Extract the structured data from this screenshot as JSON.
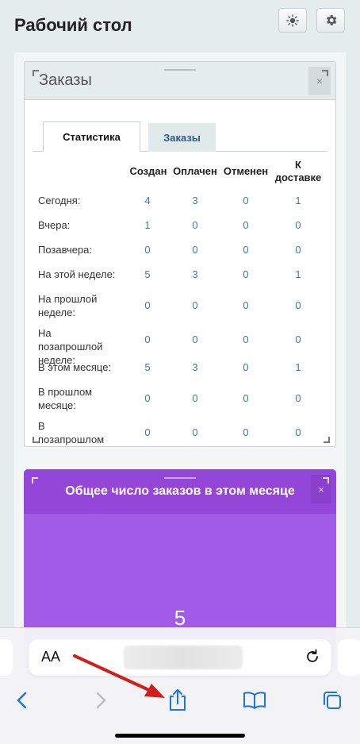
{
  "header": {
    "title": "Рабочий стол",
    "theme_icon": "sun-icon",
    "settings_icon": "gear-icon"
  },
  "orders_widget": {
    "title": "Заказы",
    "close_glyph": "×",
    "tabs": [
      {
        "label": "Статистика",
        "active": true
      },
      {
        "label": "Заказы",
        "active": false
      }
    ],
    "columns": [
      "Создан",
      "Оплачен",
      "Отменен",
      "К доставке"
    ],
    "rows": [
      {
        "label": "Сегодня:",
        "values": [
          "4",
          "3",
          "0",
          "1"
        ]
      },
      {
        "label": "Вчера:",
        "values": [
          "1",
          "0",
          "0",
          "0"
        ]
      },
      {
        "label": "Позавчера:",
        "values": [
          "0",
          "0",
          "0",
          "0"
        ]
      },
      {
        "label": "На этой неделе:",
        "values": [
          "5",
          "3",
          "0",
          "1"
        ]
      },
      {
        "label": "На прошлой неделе:",
        "values": [
          "0",
          "0",
          "0",
          "0"
        ]
      },
      {
        "label": "На позапрошлой неделе:",
        "values": [
          "0",
          "0",
          "0",
          "0"
        ]
      },
      {
        "label": "В этом месяце:",
        "values": [
          "5",
          "3",
          "0",
          "1"
        ]
      },
      {
        "label": "В прошлом месяце:",
        "values": [
          "0",
          "0",
          "0",
          "0"
        ]
      },
      {
        "label": "В позапрошлом месяце:",
        "values": [
          "0",
          "0",
          "0",
          "0"
        ]
      }
    ]
  },
  "total_widget": {
    "title": "Общее число заказов в этом месяце",
    "close_glyph": "×",
    "value": "5",
    "color": "#a25be6"
  },
  "browser": {
    "text_size_label": "AA",
    "icons": [
      "back-icon",
      "forward-icon",
      "share-icon",
      "bookmarks-icon",
      "tabs-icon",
      "reload-icon"
    ]
  },
  "annotation": {
    "arrow_color": "#d0201e",
    "points_to": "share-icon"
  }
}
